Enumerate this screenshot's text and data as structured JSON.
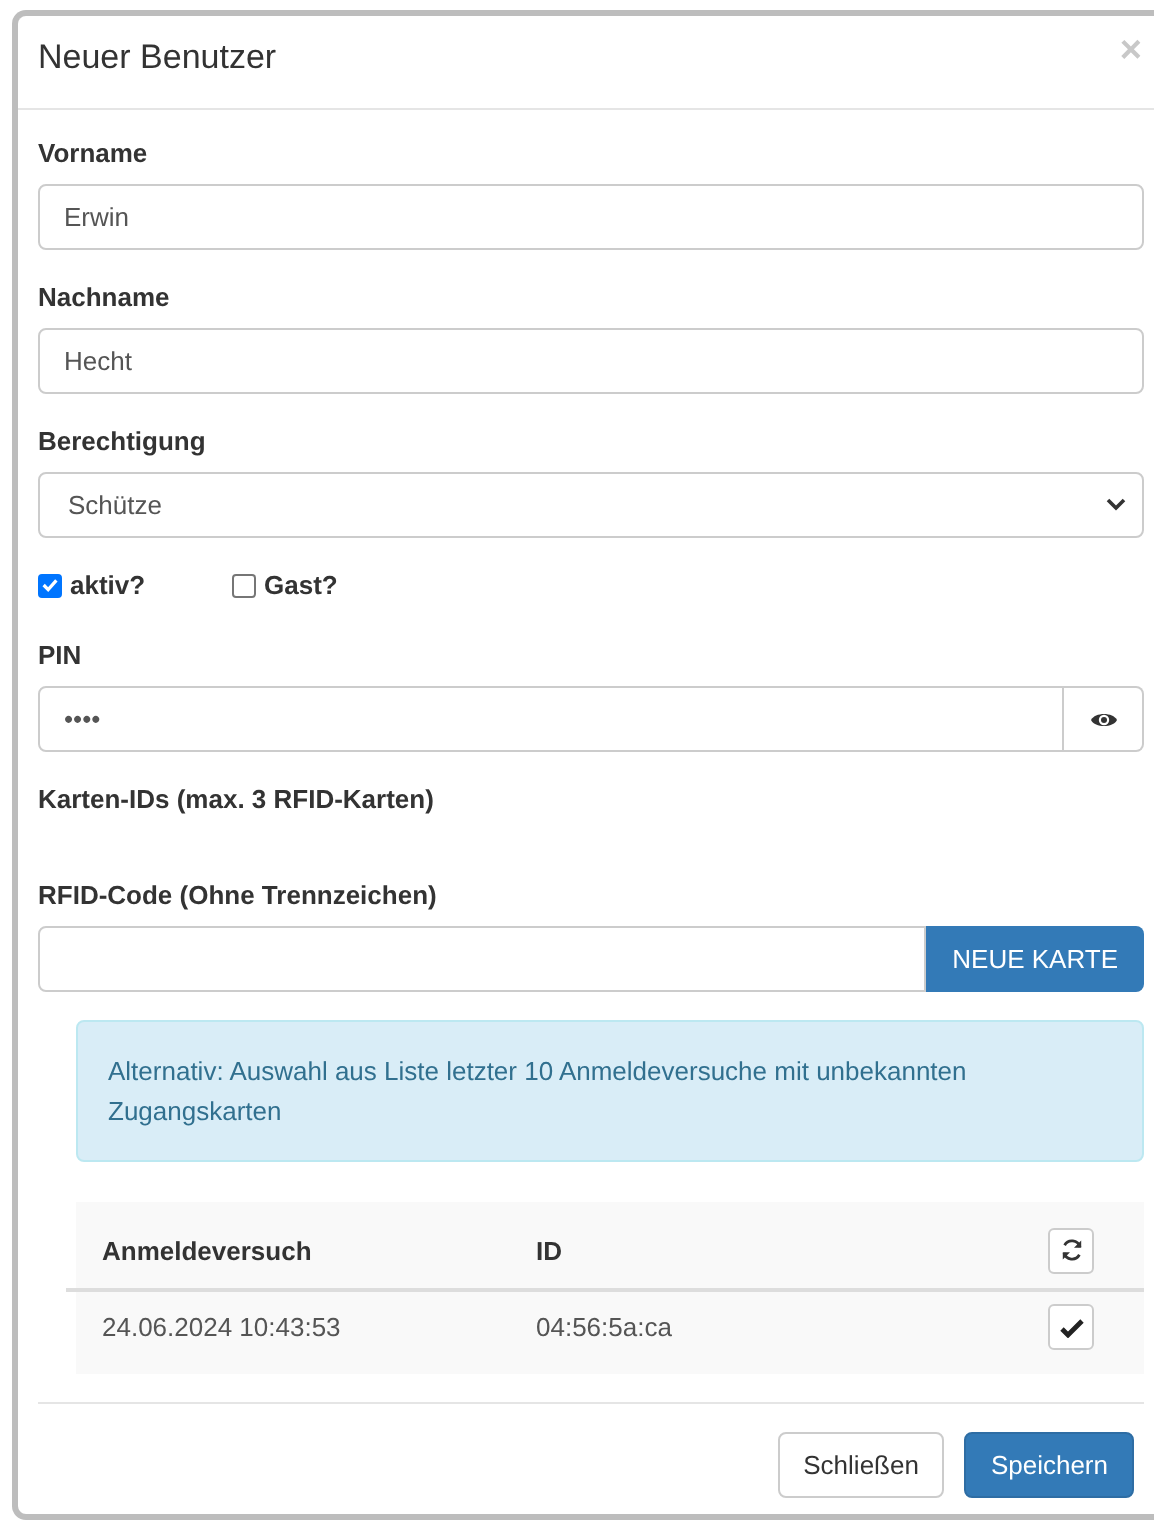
{
  "dialog": {
    "title": "Neuer Benutzer",
    "close": "×"
  },
  "fields": [
    {
      "kind": "text",
      "label": "Vorname",
      "value": "Erwin"
    },
    {
      "kind": "text",
      "label": "Nachname",
      "value": "Hecht"
    },
    {
      "kind": "select",
      "label": "Berechtigung",
      "value": "Schütze"
    }
  ],
  "checkboxes": [
    {
      "label": "aktiv?",
      "checked": true
    },
    {
      "label": "Gast?",
      "checked": false
    }
  ],
  "pin": {
    "label": "PIN",
    "value": "••••"
  },
  "cards_heading": "Karten-IDs (max. 3 RFID-Karten)",
  "rfid": {
    "label": "RFID-Code (Ohne Trennzeichen)",
    "button": "NEUE KARTE"
  },
  "alert": "Alternativ: Auswahl aus Liste letzter 10 Anmeldeversuche mit unbekannten Zugangskarten",
  "attempts": {
    "columns": [
      "Anmeldeversuch",
      "ID"
    ],
    "rows": [
      {
        "cells": [
          "24.06.2024 10:43:53",
          "04:56:5a:ca"
        ]
      }
    ]
  },
  "buttons": [
    {
      "label": "Schließen",
      "kind": "default"
    },
    {
      "label": "Speichern",
      "kind": "primary"
    }
  ]
}
